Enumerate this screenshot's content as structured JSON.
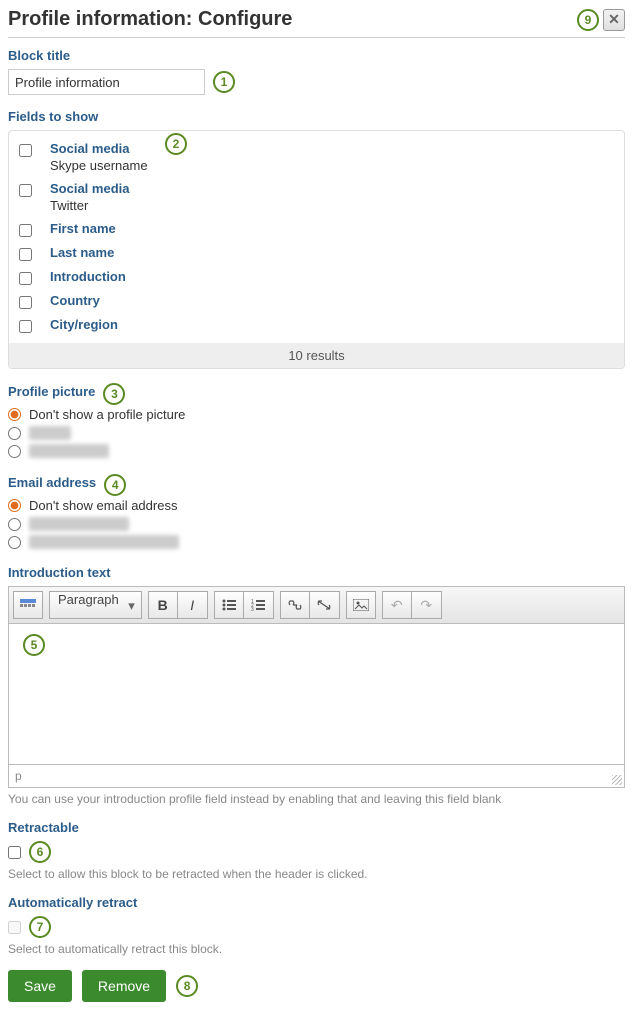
{
  "header": {
    "title": "Profile information: Configure"
  },
  "block_title": {
    "label": "Block title",
    "value": "Profile information"
  },
  "fields_to_show": {
    "label": "Fields to show",
    "items": [
      {
        "title": "Social media",
        "sub": "Skype username"
      },
      {
        "title": "Social media",
        "sub": "Twitter"
      },
      {
        "title": "First name"
      },
      {
        "title": "Last name"
      },
      {
        "title": "Introduction"
      },
      {
        "title": "Country"
      },
      {
        "title": "City/region"
      }
    ],
    "results_text": "10 results"
  },
  "profile_picture": {
    "label": "Profile picture",
    "options": [
      "Don't show a profile picture"
    ]
  },
  "email_address": {
    "label": "Email address",
    "options": [
      "Don't show email address"
    ]
  },
  "introduction": {
    "label": "Introduction text",
    "help": "You can use your introduction profile field instead by enabling that and leaving this field blank",
    "format_label": "Paragraph",
    "status_path": "p"
  },
  "retractable": {
    "label": "Retractable",
    "help": "Select to allow this block to be retracted when the header is clicked."
  },
  "auto_retract": {
    "label": "Automatically retract",
    "help": "Select to automatically retract this block."
  },
  "buttons": {
    "save": "Save",
    "remove": "Remove"
  },
  "callouts": {
    "c1": "1",
    "c2": "2",
    "c3": "3",
    "c4": "4",
    "c5": "5",
    "c6": "6",
    "c7": "7",
    "c8": "8",
    "c9": "9"
  }
}
